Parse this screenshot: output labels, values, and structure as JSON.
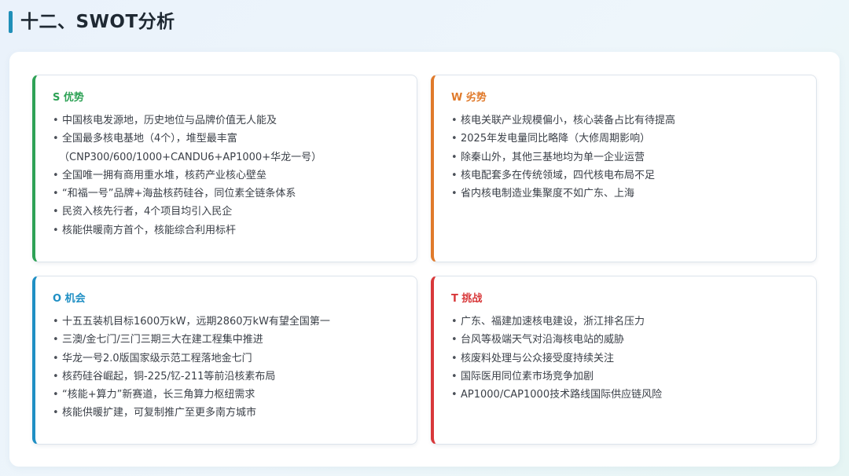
{
  "page": {
    "title": "十二、SWOT分析"
  },
  "colors": {
    "accent_bar": "#1f8fb8",
    "strengths": "#2ea256",
    "weaknesses": "#e07a2b",
    "opportunities": "#1f8fc4",
    "threats": "#d8383a"
  },
  "bullet": "•",
  "swot": {
    "strengths": {
      "title": "S 优势",
      "items": [
        "中国核电发源地，历史地位与品牌价值无人能及",
        "全国最多核电基地（4个），堆型最丰富",
        "（CNP300/600/1000+CANDU6+AP1000+华龙一号）",
        "全国唯一拥有商用重水堆，核药产业核心壁垒",
        "“和福一号”品牌+海盐核药硅谷，同位素全链条体系",
        "民资入核先行者，4个项目均引入民企",
        "核能供暖南方首个，核能综合利用标杆"
      ]
    },
    "weaknesses": {
      "title": "W 劣势",
      "items": [
        "核电关联产业规模偏小，核心装备占比有待提高",
        "2025年发电量同比略降（大修周期影响）",
        "除秦山外，其他三基地均为单一企业运营",
        "核电配套多在传统领域，四代核电布局不足",
        "省内核电制造业集聚度不如广东、上海"
      ]
    },
    "opportunities": {
      "title": "O 机会",
      "items": [
        "十五五装机目标1600万kW，远期2860万kW有望全国第一",
        "三澳/金七门/三门三期三大在建工程集中推进",
        "华龙一号2.0版国家级示范工程落地金七门",
        "核药硅谷崛起，铜-225/钇-211等前沿核素布局",
        "“核能+算力”新赛道，长三角算力枢纽需求",
        "核能供暖扩建，可复制推广至更多南方城市"
      ]
    },
    "threats": {
      "title": "T 挑战",
      "items": [
        "广东、福建加速核电建设，浙江排名压力",
        "台风等极端天气对沿海核电站的威胁",
        "核废料处理与公众接受度持续关注",
        "国际医用同位素市场竞争加剧",
        "AP1000/CAP1000技术路线国际供应链风险"
      ]
    }
  }
}
